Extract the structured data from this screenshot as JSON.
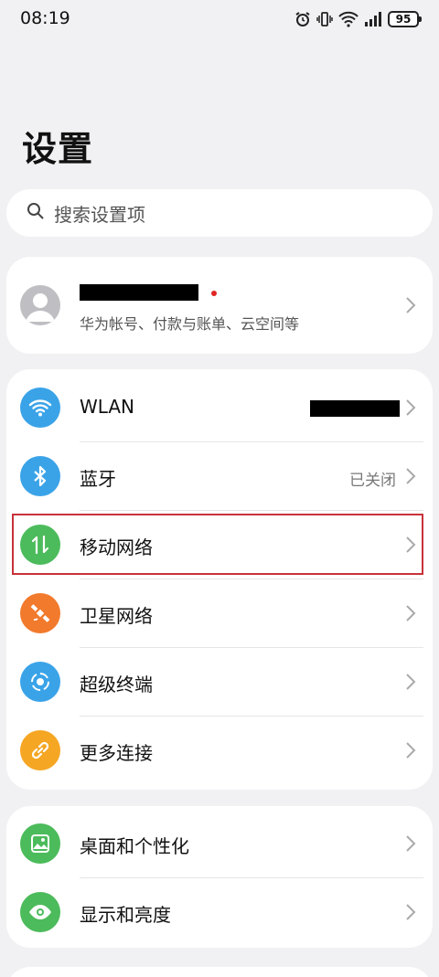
{
  "status_bar": {
    "time": "08:19",
    "battery": "95"
  },
  "page": {
    "title": "设置"
  },
  "search": {
    "placeholder": "搜索设置项"
  },
  "account": {
    "subtitle": "华为帐号、付款与账单、云空间等"
  },
  "connectivity": {
    "items": [
      {
        "label": "WLAN",
        "value": "",
        "icon": "wifi-icon",
        "color": "#3aa3e8"
      },
      {
        "label": "蓝牙",
        "value": "已关闭",
        "icon": "bluetooth-icon",
        "color": "#3aa3e8"
      },
      {
        "label": "移动网络",
        "value": "",
        "icon": "mobile-data-icon",
        "color": "#4cbb5b"
      },
      {
        "label": "卫星网络",
        "value": "",
        "icon": "satellite-icon",
        "color": "#f17a2c"
      },
      {
        "label": "超级终端",
        "value": "",
        "icon": "super-device-icon",
        "color": "#3aa3e8"
      },
      {
        "label": "更多连接",
        "value": "",
        "icon": "link-icon",
        "color": "#f5a623"
      }
    ]
  },
  "display": {
    "items": [
      {
        "label": "桌面和个性化",
        "icon": "wallpaper-icon",
        "color": "#4cbb5b"
      },
      {
        "label": "显示和亮度",
        "icon": "eye-icon",
        "color": "#4cbb5b"
      }
    ]
  }
}
